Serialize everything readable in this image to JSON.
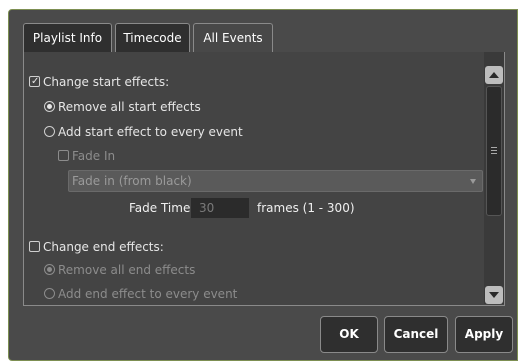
{
  "tabs": [
    {
      "label": "Playlist Info",
      "active": false
    },
    {
      "label": "Timecode",
      "active": false
    },
    {
      "label": "All Events",
      "active": true
    }
  ],
  "start_effects": {
    "checkbox_label": "Change start effects:",
    "checked": true,
    "remove_label": "Remove all start effects",
    "remove_selected": true,
    "add_label": "Add start effect to every event",
    "add_selected": false,
    "fade_in_label": "Fade In",
    "fade_in_checked": false,
    "effect_select_value": "Fade in (from black)",
    "fade_time_label": "Fade Time",
    "fade_time_value": "30",
    "fade_time_unit": "frames (1 - 300)"
  },
  "end_effects": {
    "checkbox_label": "Change end effects:",
    "checked": false,
    "remove_label": "Remove all end effects",
    "remove_selected": true,
    "add_label": "Add end effect to every event",
    "add_selected": false
  },
  "buttons": {
    "ok": "OK",
    "cancel": "Cancel",
    "apply": "Apply"
  },
  "colors": {
    "window_bg": "#4a4a4a",
    "panel_bg": "#444444",
    "button_bg": "#2f2f2f",
    "border": "#8a8a8a",
    "disabled_text": "#8c8c8c"
  }
}
